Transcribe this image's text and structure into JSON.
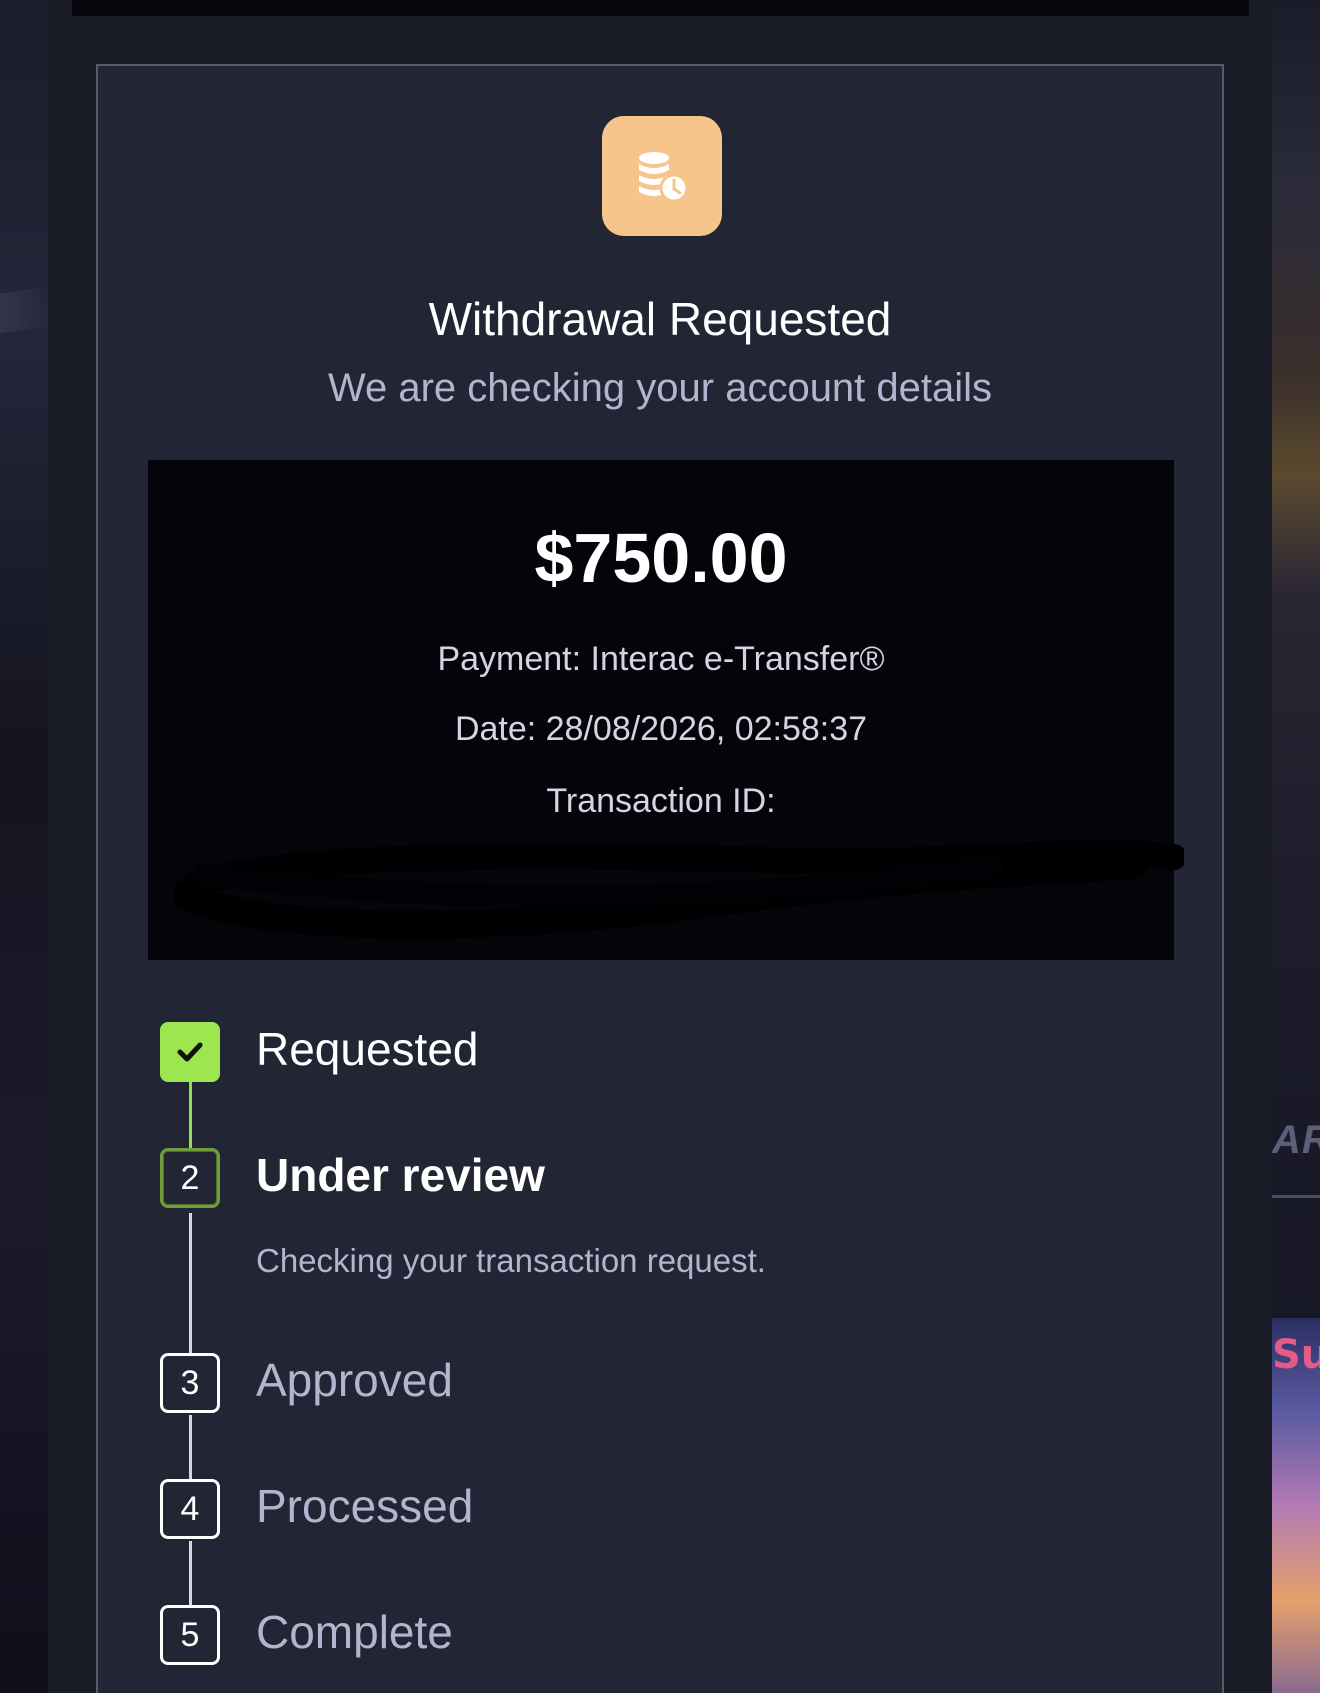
{
  "header": {
    "icon": "coins-clock-icon",
    "title": "Withdrawal Requested",
    "subtitle": "We are checking your account details"
  },
  "transaction": {
    "amount": "$750.00",
    "payment": "Payment: Interac e-Transfer®",
    "date": "Date: 28/08/2026, 02:58:37",
    "transaction_id_label": "Transaction ID:"
  },
  "steps": [
    {
      "number": "1",
      "label": "Requested",
      "status": "done"
    },
    {
      "number": "2",
      "label": "Under review",
      "status": "current",
      "description": "Checking your transaction request."
    },
    {
      "number": "3",
      "label": "Approved",
      "status": "pending"
    },
    {
      "number": "4",
      "label": "Processed",
      "status": "pending"
    },
    {
      "number": "5",
      "label": "Complete",
      "status": "pending"
    }
  ],
  "background": {
    "right_text": "AR",
    "game_text": "Su"
  },
  "colors": {
    "icon_tile": "#f6c58c",
    "step_done": "#9ee650",
    "card_bg": "#222533",
    "muted_text": "#b7b3cf"
  }
}
